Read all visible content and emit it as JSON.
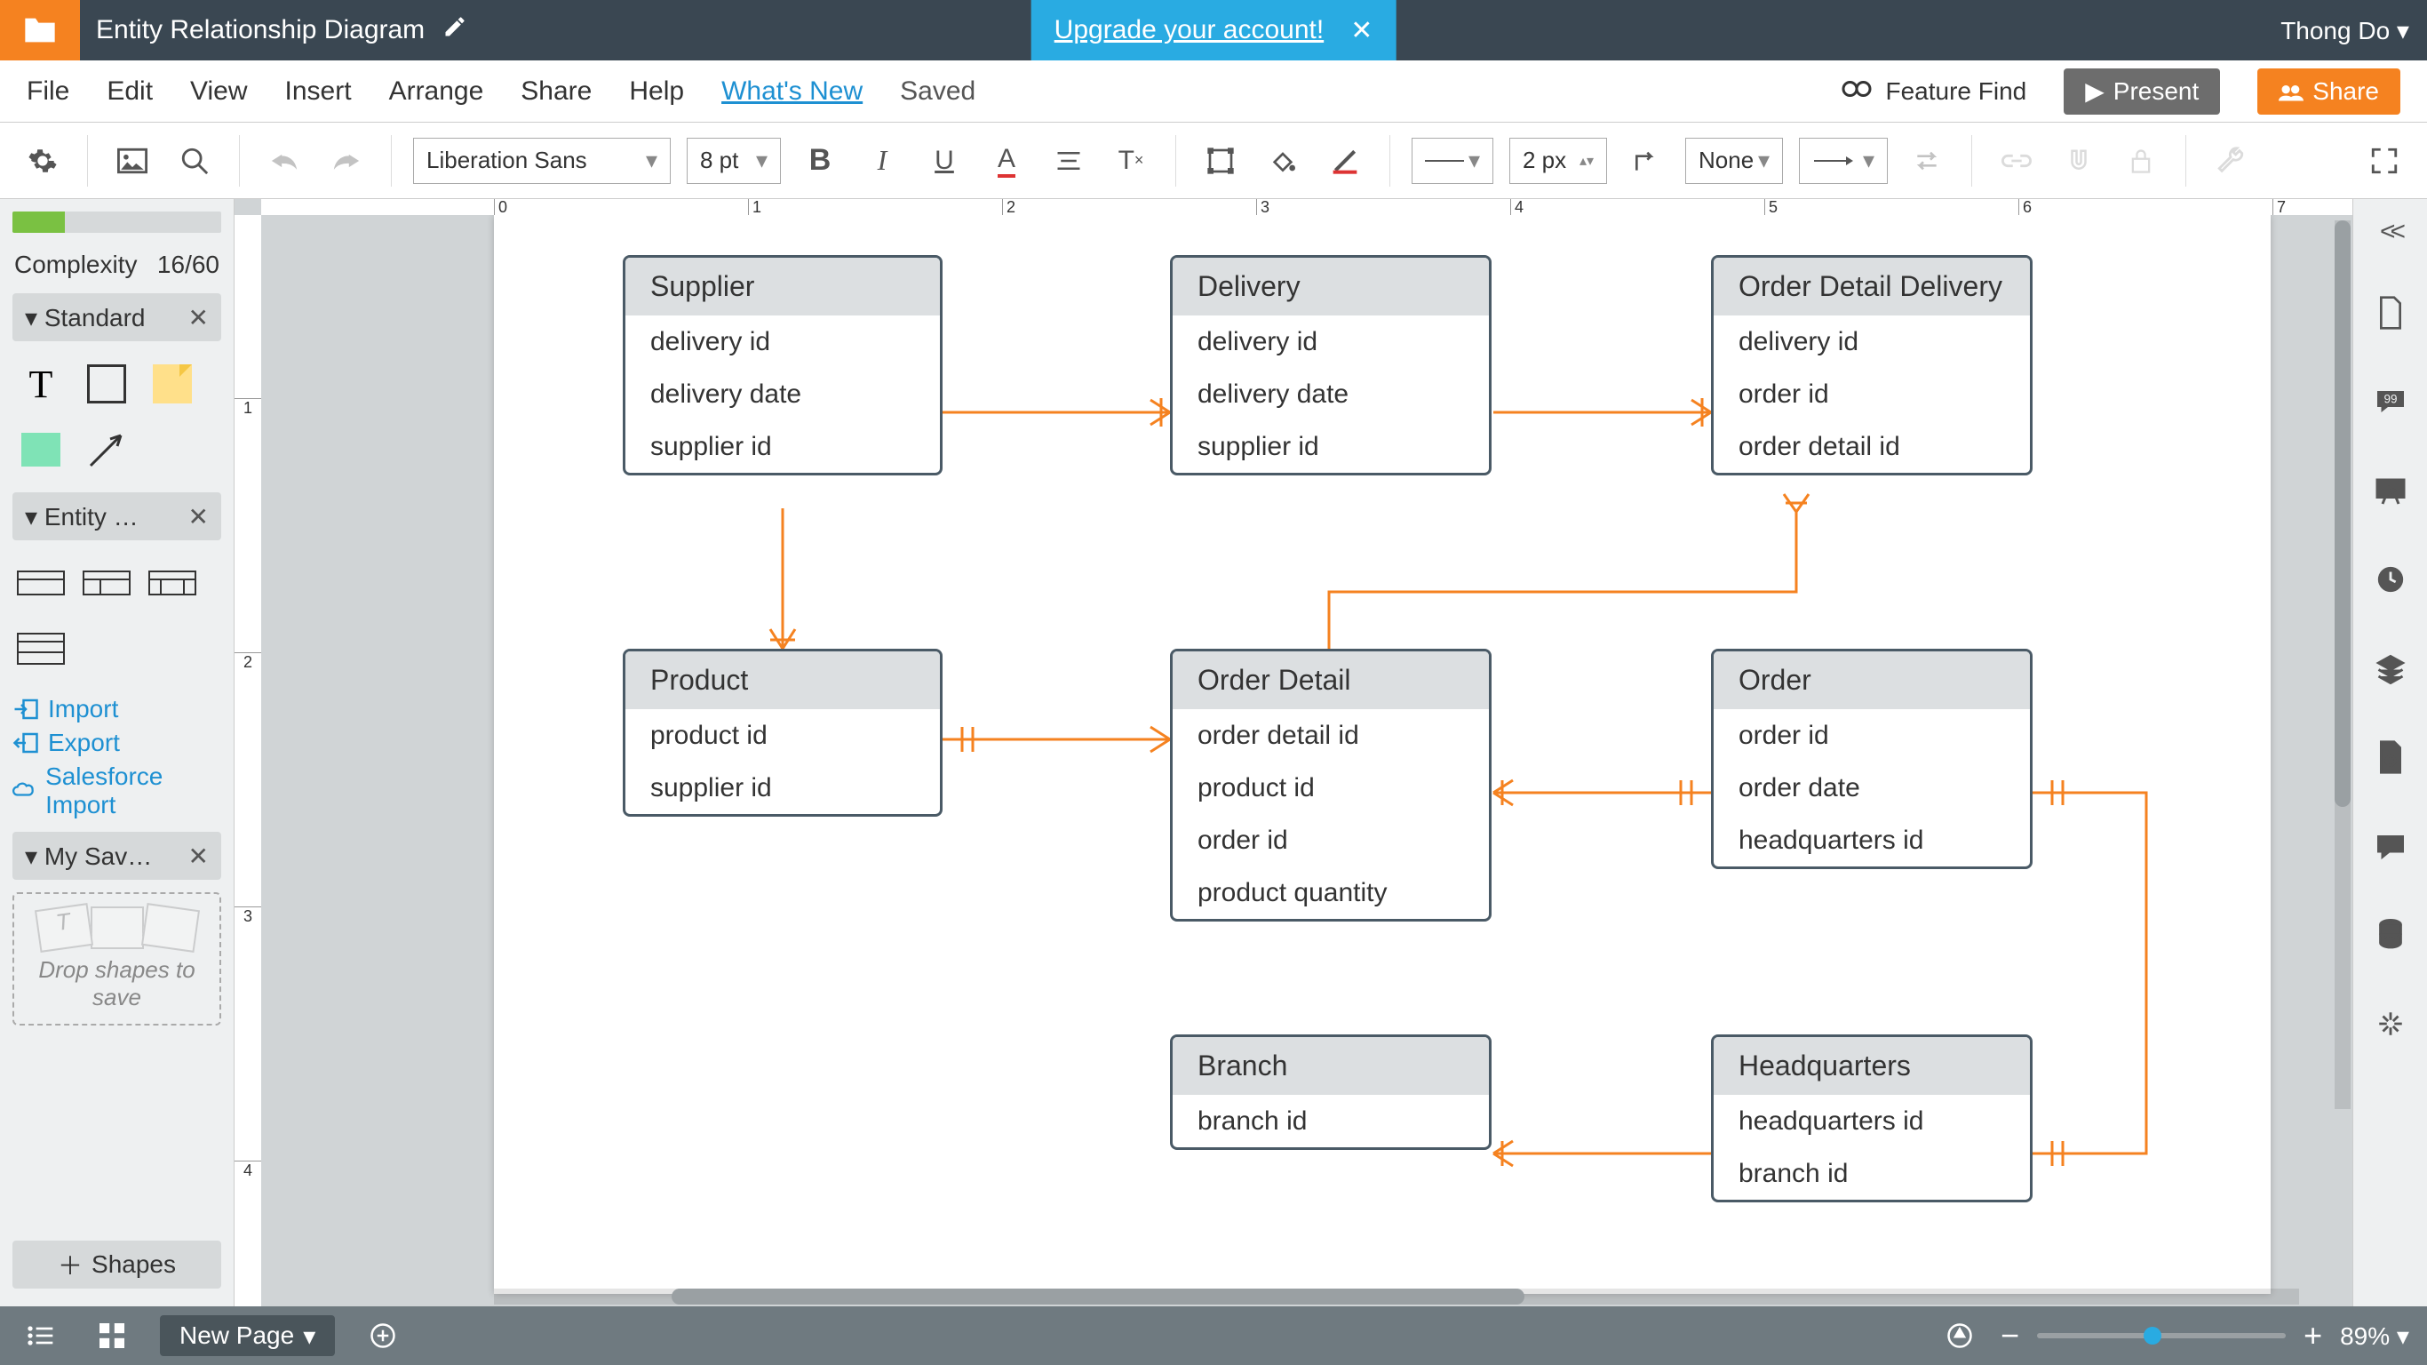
{
  "doc": {
    "title": "Entity Relationship Diagram",
    "user": "Thong Do"
  },
  "upgrade": {
    "text": "Upgrade your account!"
  },
  "menu": {
    "file": "File",
    "edit": "Edit",
    "view": "View",
    "insert": "Insert",
    "arrange": "Arrange",
    "share": "Share",
    "help": "Help",
    "whatsnew": "What's New",
    "saved": "Saved",
    "feature_find": "Feature Find",
    "present": "Present",
    "share_btn": "Share"
  },
  "toolbar": {
    "font": "Liberation Sans",
    "size": "8 pt",
    "line_width": "2 px",
    "line_endcap": "None"
  },
  "left": {
    "complexity_label": "Complexity",
    "complexity_value": "16/60",
    "group_standard": "Standard",
    "group_entity": "Entity …",
    "group_saved": "My Sav…",
    "import": "Import",
    "export": "Export",
    "salesforce": "Salesforce Import",
    "drop_hint": "Drop shapes to save",
    "shapes_btn": "Shapes"
  },
  "bottom": {
    "page": "New Page",
    "zoom": "89%"
  },
  "er": {
    "supplier": {
      "title": "Supplier",
      "fields": [
        "delivery id",
        "delivery date",
        "supplier id"
      ]
    },
    "delivery": {
      "title": "Delivery",
      "fields": [
        "delivery id",
        "delivery date",
        "supplier id"
      ]
    },
    "odd": {
      "title": "Order Detail Delivery",
      "fields": [
        "delivery id",
        "order id",
        "order detail id"
      ]
    },
    "product": {
      "title": "Product",
      "fields": [
        "product id",
        "supplier id"
      ]
    },
    "orderdetail": {
      "title": "Order Detail",
      "fields": [
        "order detail id",
        "product id",
        "order id",
        "product quantity"
      ]
    },
    "order": {
      "title": "Order",
      "fields": [
        "order id",
        "order date",
        "headquarters id"
      ]
    },
    "branch": {
      "title": "Branch",
      "fields": [
        "branch id"
      ]
    },
    "hq": {
      "title": "Headquarters",
      "fields": [
        "headquarters id",
        "branch id"
      ]
    }
  }
}
